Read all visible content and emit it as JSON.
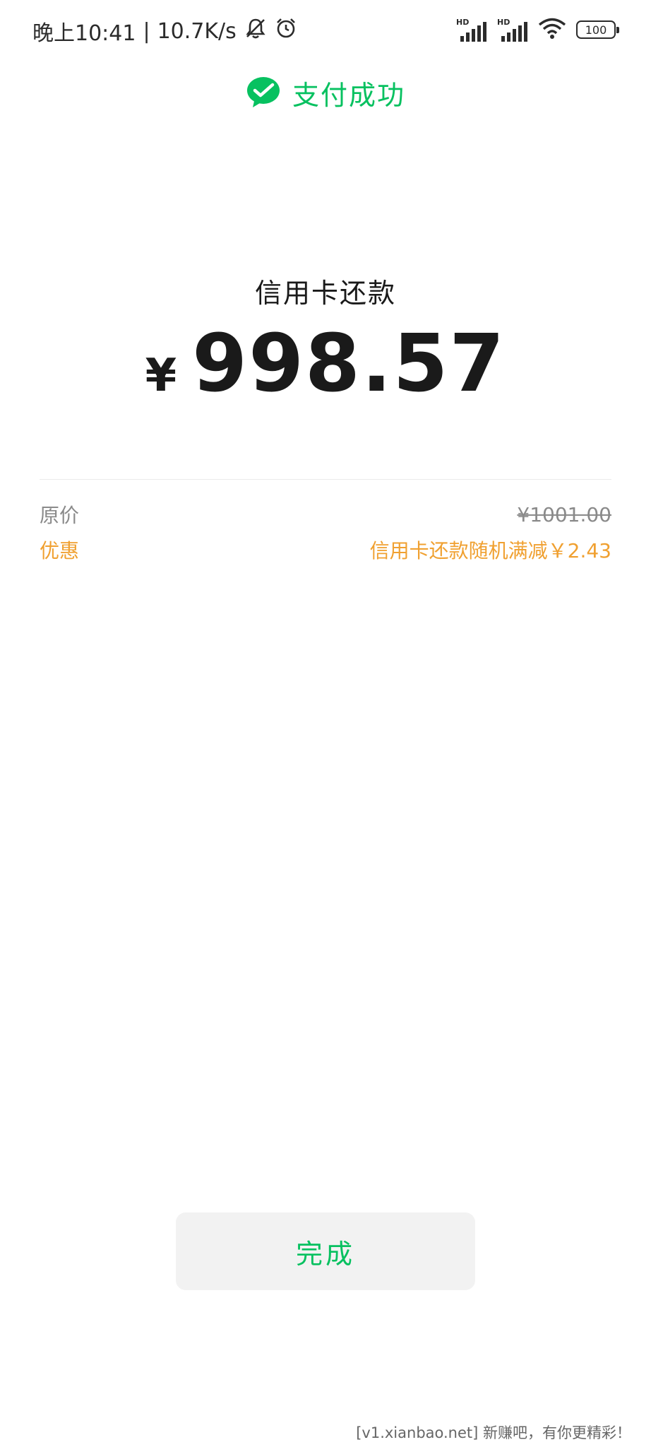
{
  "status_bar": {
    "time": "晚上10:41",
    "separator": "|",
    "net_speed": "10.7K/s",
    "icons": [
      "bell-muted-icon",
      "alarm-clock-icon",
      "hd-signal-icon",
      "hd-signal-icon",
      "wifi-icon",
      "battery-icon"
    ],
    "hd_label": "HD",
    "battery": "100"
  },
  "header": {
    "title": "支付成功",
    "icon": "check-bubble-icon",
    "accent_color": "#07c160"
  },
  "payment": {
    "merchant": "信用卡还款",
    "currency": "¥",
    "amount": "998.57"
  },
  "details": {
    "original_label": "原价",
    "original_value": "¥1001.00",
    "discount_label": "优惠",
    "discount_value": "信用卡还款随机满减￥2.43",
    "discount_color": "#f0a030"
  },
  "actions": {
    "done_label": "完成"
  },
  "watermark": "[v1.xianbao.net] 新赚吧，有你更精彩！"
}
